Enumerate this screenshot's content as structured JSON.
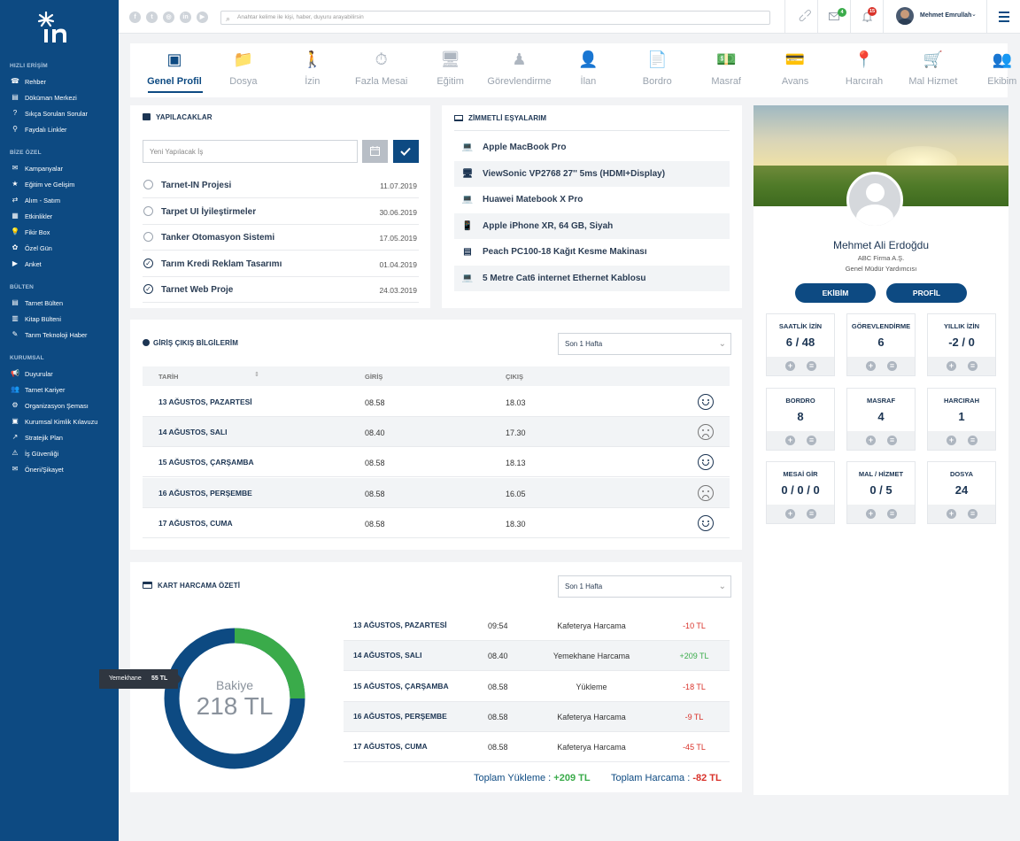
{
  "sidebar": {
    "sections": [
      {
        "label": "HIZLI ERİŞİM",
        "items": [
          "Rehber",
          "Döküman Merkezi",
          "Sıkça Sorulan Sorular",
          "Faydalı Linkler"
        ]
      },
      {
        "label": "BİZE ÖZEL",
        "items": [
          "Kampanyalar",
          "Eğitim ve Gelişim",
          "Alım - Satım",
          "Etkinlikler",
          "Fikir Box",
          "Özel Gün",
          "Anket"
        ]
      },
      {
        "label": "BÜLTEN",
        "items": [
          "Tarnet Bülten",
          "Kitap Bülteni",
          "Tarım Teknoloji Haber"
        ]
      },
      {
        "label": "KURUMSAL",
        "items": [
          "Duyurular",
          "Tarnet Kariyer",
          "Organizasyon Şeması",
          "Kurumsal Kimlik Kılavuzu",
          "Stratejik Plan",
          "İş Güvenliği",
          "Öneri/Şikayet"
        ]
      }
    ]
  },
  "topbar": {
    "search_placeholder": "Anahtar kelime ile kişi, haber, duyuru arayabilirsin",
    "mail_count": "4",
    "notif_count": "15",
    "user_name": "Mehmet Emrullah"
  },
  "tabs": [
    "Genel Profil",
    "Dosya",
    "İzin",
    "Fazla Mesai",
    "Eğitim",
    "Görevlendirme",
    "İlan",
    "Bordro",
    "Masraf",
    "Avans",
    "Harcırah",
    "Mal Hizmet",
    "Ekibim"
  ],
  "todo": {
    "title": "YAPILACAKLAR",
    "input_placeholder": "Yeni Yapılacak İş",
    "items": [
      {
        "text": "Tarnet-IN Projesi",
        "date": "11.07.2019",
        "done": false
      },
      {
        "text": "Tarpet UI İyileştirmeler",
        "date": "30.06.2019",
        "done": false
      },
      {
        "text": "Tanker Otomasyon Sistemi",
        "date": "17.05.2019",
        "done": false
      },
      {
        "text": "Tarım Kredi Reklam Tasarımı",
        "date": "01.04.2019",
        "done": true
      },
      {
        "text": "Tarnet Web Proje",
        "date": "24.03.2019",
        "done": true
      }
    ]
  },
  "assets": {
    "title": "ZİMMETLİ EŞYALARIM",
    "items": [
      "Apple MacBook Pro",
      "ViewSonic VP2768 27'' 5ms (HDMI+Display)",
      "Huawei Matebook X Pro",
      "Apple iPhone XR, 64 GB, Siyah",
      "Peach PC100-18 Kağıt Kesme Makinası",
      "5 Metre Cat6 internet Ethernet Kablosu"
    ]
  },
  "attendance": {
    "title": "GİRİŞ ÇIKIŞ BİLGİLERİM",
    "filter": "Son 1 Hafta",
    "headers": [
      "TARİH",
      "GİRİŞ",
      "ÇIKIŞ"
    ],
    "rows": [
      {
        "date": "13 AĞUSTOS, PAZARTESİ",
        "in": "08.58",
        "out": "18.03",
        "mood": "happy"
      },
      {
        "date": "14 AĞUSTOS, SALI",
        "in": "08.40",
        "out": "17.30",
        "mood": "sad"
      },
      {
        "date": "15 AĞUSTOS, ÇARŞAMBA",
        "in": "08.58",
        "out": "18.13",
        "mood": "happy"
      },
      {
        "date": "16 AĞUSTOS, PERŞEMBE",
        "in": "08.58",
        "out": "16.05",
        "mood": "sad"
      },
      {
        "date": "17 AĞUSTOS, CUMA",
        "in": "08.58",
        "out": "18.30",
        "mood": "happy"
      }
    ]
  },
  "card_spend": {
    "title": "KART HARCAMA ÖZETİ",
    "filter": "Son 1 Hafta",
    "balance_label": "Bakiye",
    "balance_value": "218 TL",
    "tooltip_label": "Yemekhane",
    "tooltip_value": "55 TL",
    "donut_green_fraction": 0.25,
    "rows": [
      {
        "date": "13 AĞUSTOS, PAZARTESİ",
        "time": "09:54",
        "desc": "Kafeterya Harcama",
        "amount": "-10 TL"
      },
      {
        "date": "14 AĞUSTOS, SALI",
        "time": "08.40",
        "desc": "Yemekhane Harcama",
        "amount": "+209 TL"
      },
      {
        "date": "15 AĞUSTOS, ÇARŞAMBA",
        "time": "08.58",
        "desc": "Yükleme",
        "amount": "-18 TL"
      },
      {
        "date": "16 AĞUSTOS, PERŞEMBE",
        "time": "08.58",
        "desc": "Kafeterya Harcama",
        "amount": "-9 TL"
      },
      {
        "date": "17 AĞUSTOS, CUMA",
        "time": "08.58",
        "desc": "Kafeterya Harcama",
        "amount": "-45 TL"
      }
    ],
    "total_load_label": "Toplam Yükleme :",
    "total_load_value": "+209 TL",
    "total_spend_label": "Toplam Harcama :",
    "total_spend_value": "-82 TL"
  },
  "profile": {
    "name": "Mehmet Ali Erdoğdu",
    "company": "ABC Firma A.Ş.",
    "role": "Genel Müdür Yardımcısı",
    "team_button": "EKİBİM",
    "profile_button": "PROFİL",
    "stats": [
      {
        "label": "SAATLİK İZİN",
        "value": "6 / 48"
      },
      {
        "label": "GÖREVLENDİRME",
        "value": "6"
      },
      {
        "label": "YILLIK İZİN",
        "value": "-2 / 0"
      },
      {
        "label": "BORDRO",
        "value": "8"
      },
      {
        "label": "MASRAF",
        "value": "4"
      },
      {
        "label": "HARCIRAH",
        "value": "1"
      },
      {
        "label": "MESAİ GİR",
        "value": "0 / 0 / 0"
      },
      {
        "label": "MAL / HİZMET",
        "value": "0 / 5"
      },
      {
        "label": "DOSYA",
        "value": "24"
      }
    ]
  },
  "colors": {
    "brand": "#0d4a82",
    "green": "#3aab4a",
    "red": "#d9322a"
  }
}
